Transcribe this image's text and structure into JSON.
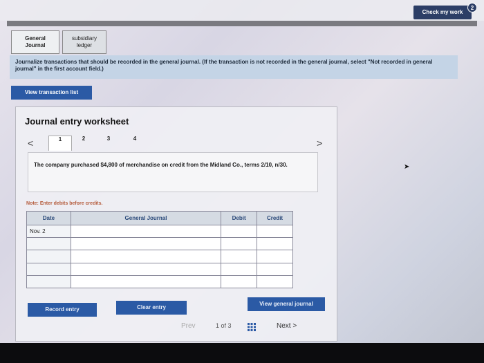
{
  "header": {
    "check_work_label": "Check my work",
    "badge_count": "2"
  },
  "tabs": [
    {
      "label_line1": "General",
      "label_line2": "Journal"
    },
    {
      "label_line1": "subsidiary",
      "label_line2": "ledger"
    }
  ],
  "instruction": {
    "text": "Journalize transactions that should be recorded in the general journal. (If the transaction is not recorded in the general journal, select \"Not recorded in general journal\" in the first account field.)"
  },
  "view_transaction_label": "View transaction list",
  "worksheet": {
    "title": "Journal entry worksheet",
    "prev_glyph": "<",
    "next_glyph": ">",
    "steps": [
      "1",
      "2",
      "3",
      "4"
    ],
    "transaction_text": "The company purchased $4,800 of merchandise on credit from the Midland Co., terms 2/10, n/30.",
    "note": "Note: Enter debits before credits."
  },
  "journal_table": {
    "headers": {
      "date": "Date",
      "account": "General Journal",
      "debit": "Debit",
      "credit": "Credit"
    },
    "rows": [
      {
        "date": "Nov. 2",
        "account": "",
        "debit": "",
        "credit": ""
      },
      {
        "date": "",
        "account": "",
        "debit": "",
        "credit": ""
      },
      {
        "date": "",
        "account": "",
        "debit": "",
        "credit": ""
      },
      {
        "date": "",
        "account": "",
        "debit": "",
        "credit": ""
      },
      {
        "date": "",
        "account": "",
        "debit": "",
        "credit": ""
      }
    ]
  },
  "buttons": {
    "record": "Record entry",
    "clear": "Clear entry",
    "view_general_journal": "View general journal"
  },
  "pagination": {
    "prev_label": "Prev",
    "count_text": "1 of 3",
    "next_label": "Next >"
  }
}
